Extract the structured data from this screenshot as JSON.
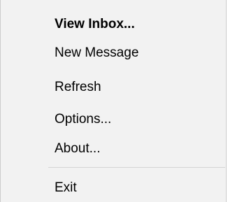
{
  "menu": {
    "items": [
      {
        "label": "View Inbox...",
        "default": true
      },
      {
        "label": "New Message"
      },
      {
        "label": "Refresh"
      },
      {
        "label": "Options..."
      },
      {
        "label": "About..."
      }
    ],
    "exit_label": "Exit"
  },
  "colors": {
    "background": "#f2f2f2",
    "text": "#000000",
    "separator": "#d4d4d4",
    "border": "#cccccc"
  }
}
